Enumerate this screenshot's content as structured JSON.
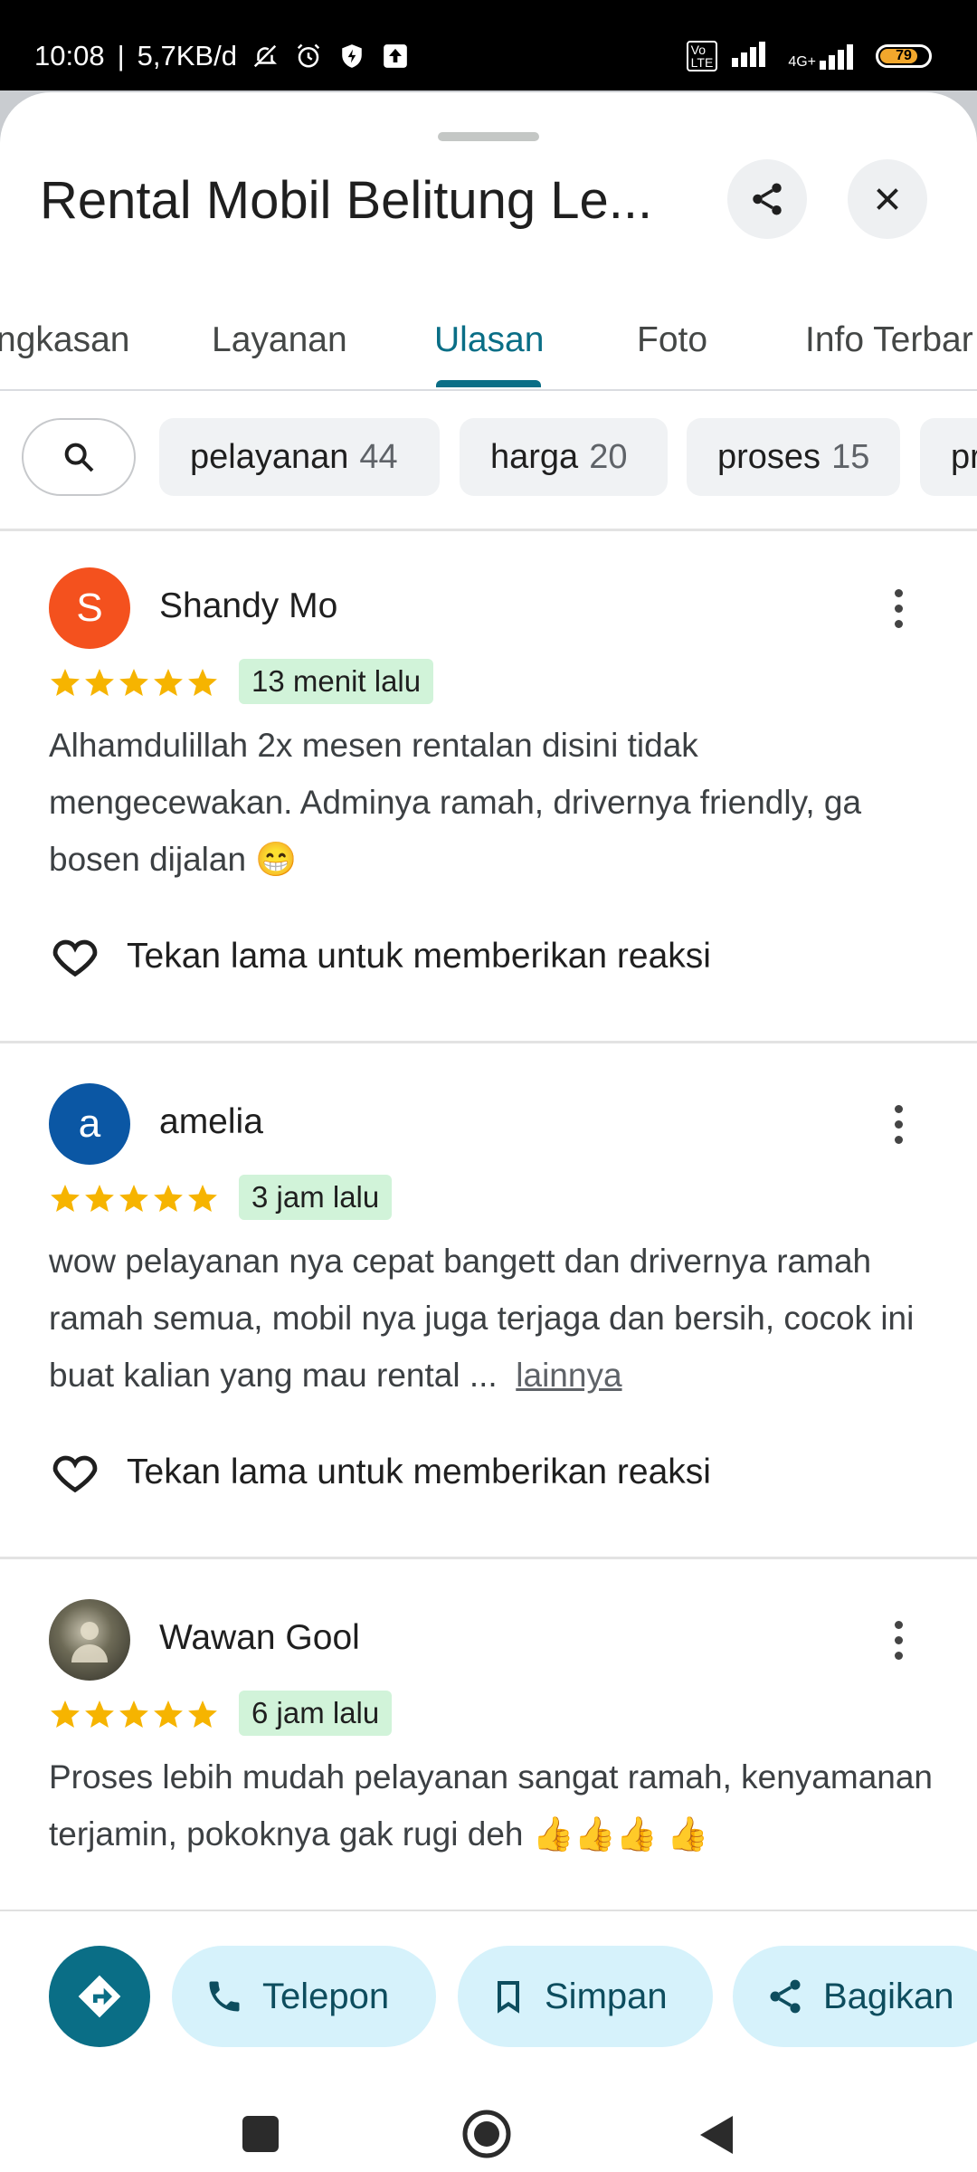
{
  "status_bar": {
    "time": "10:08",
    "net_speed": "5,7KB/d",
    "battery": "79",
    "signal_label": "4G+"
  },
  "header": {
    "title": "Rental Mobil Belitung Le...",
    "share_icon": "share-icon",
    "close_icon": "close-icon"
  },
  "tabs": [
    {
      "label": "ngkasan"
    },
    {
      "label": "Layanan"
    },
    {
      "label": "Ulasan",
      "active": true
    },
    {
      "label": "Foto"
    },
    {
      "label": "Info Terbar"
    }
  ],
  "chips": [
    {
      "label": "pelayanan",
      "count": "44"
    },
    {
      "label": "harga",
      "count": "20"
    },
    {
      "label": "proses",
      "count": "15"
    },
    {
      "label": "pr",
      "count": ""
    }
  ],
  "reviews": [
    {
      "name": "Shandy Mo",
      "initial": "S",
      "avatar_color": "#f4511e",
      "rating": 5,
      "time": "13 menit lalu",
      "text": "Alhamdulillah 2x mesen rentalan disini tidak mengecewakan. Adminya ramah, drivernya friendly, ga bosen dijalan 😁",
      "more": "",
      "reaction": "Tekan lama untuk memberikan reaksi"
    },
    {
      "name": "amelia",
      "initial": "a",
      "avatar_color": "#0b57a4",
      "rating": 5,
      "time": "3 jam lalu",
      "text": "wow pelayanan nya cepat bangett dan drivernya ramah ramah semua,  mobil nya juga terjaga dan bersih, cocok ini buat kalian yang mau rental ...",
      "more": "lainnya",
      "reaction": "Tekan lama untuk memberikan reaksi"
    },
    {
      "name": "Wawan Gool",
      "initial": "",
      "avatar_color": "#4a4a3a",
      "rating": 5,
      "time": "6 jam lalu",
      "text": "Proses lebih mudah pelayanan sangat ramah, kenyamanan terjamin, pokoknya gak rugi deh 👍👍👍 👍",
      "more": "",
      "reaction": ""
    }
  ],
  "actions": {
    "telepon": "Telepon",
    "simpan": "Simpan",
    "bagikan": "Bagikan"
  },
  "colors": {
    "accent": "#0a6e86",
    "star": "#f6b400",
    "time_badge": "#d1f3d9",
    "pill_bg": "#d6f2fb"
  }
}
